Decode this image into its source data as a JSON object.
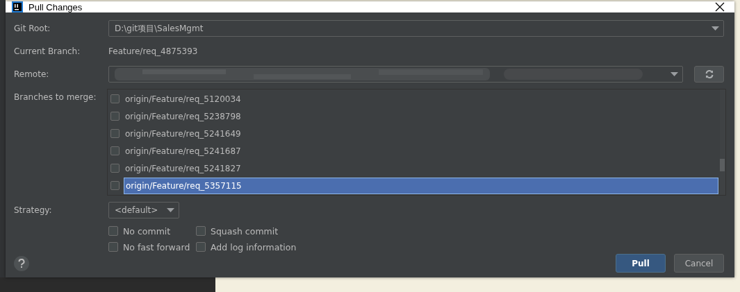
{
  "window": {
    "title": "Pull Changes"
  },
  "git_root": {
    "label": "Git Root:",
    "value": "D:\\git项目\\SalesMgmt"
  },
  "current_branch": {
    "label": "Current Branch:",
    "value": "Feature/req_4875393"
  },
  "remote": {
    "label": "Remote:"
  },
  "branches": {
    "label": "Branches to merge:",
    "items": [
      {
        "name": "origin/Feature/req_5120034",
        "checked": false,
        "selected": false
      },
      {
        "name": "origin/Feature/req_5238798",
        "checked": false,
        "selected": false
      },
      {
        "name": "origin/Feature/req_5241649",
        "checked": false,
        "selected": false
      },
      {
        "name": "origin/Feature/req_5241687",
        "checked": false,
        "selected": false
      },
      {
        "name": "origin/Feature/req_5241827",
        "checked": false,
        "selected": false
      },
      {
        "name": "origin/Feature/req_5357115",
        "checked": false,
        "selected": true
      }
    ]
  },
  "strategy": {
    "label": "Strategy:",
    "value": "<default>"
  },
  "options": [
    {
      "label": "No commit",
      "checked": false
    },
    {
      "label": "Squash commit",
      "checked": false
    },
    {
      "label": "No fast forward",
      "checked": false
    },
    {
      "label": "Add log information",
      "checked": false
    }
  ],
  "buttons": [
    {
      "label": "Pull",
      "kind": "primary"
    },
    {
      "label": "Cancel",
      "kind": "secondary"
    }
  ]
}
